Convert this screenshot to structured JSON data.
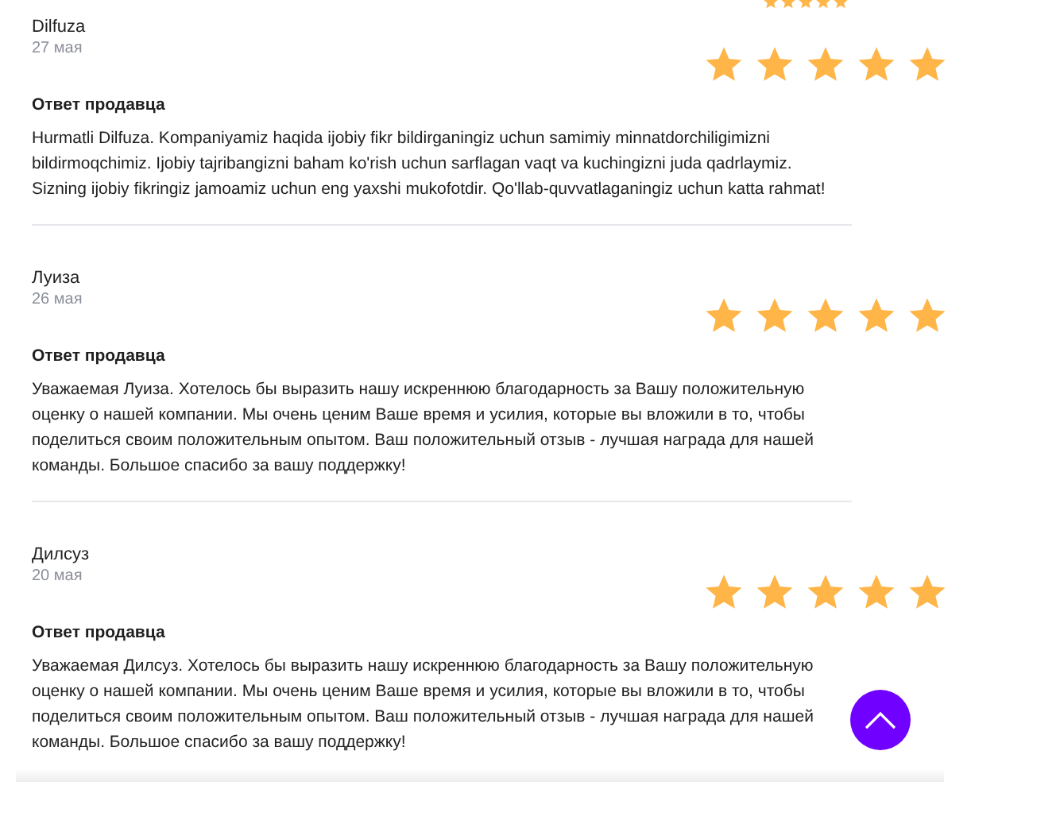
{
  "top_stars": {
    "stars": 5
  },
  "reviews": [
    {
      "name": "Dilfuza",
      "date": "27 мая",
      "stars": 5,
      "reply_title": "Ответ продавца",
      "reply": "Hurmatli Dilfuza. Kompaniyamiz haqida ijobiy fikr bildirganingiz uchun samimiy minnatdorchiligimizni bildirmoqchimiz. Ijobiy tajribangizni baham ko'rish uchun sarflagan vaqt va kuchingizni juda qadrlaymiz. Sizning ijobiy fikringiz jamoamiz uchun eng yaxshi mukofotdir. Qo'llab-quvvatlaganingiz uchun katta rahmat!"
    },
    {
      "name": "Луиза",
      "date": "26 мая",
      "stars": 5,
      "reply_title": "Ответ продавца",
      "reply": "Уважаемая Луиза. Хотелось бы выразить нашу искреннюю благодарность за Вашу положительную оценку о нашей компании. Мы очень ценим Ваше время и усилия, которые вы вложили в то, чтобы поделиться своим положительным опытом. Ваш положительный отзыв - лучшая награда для нашей команды. Большое спасибо за вашу поддержку!"
    },
    {
      "name": "Дилсуз",
      "date": "20 мая",
      "stars": 5,
      "reply_title": "Ответ продавца",
      "reply": "Уважаемая Дилсуз. Хотелось бы выразить нашу искреннюю благодарность за Вашу положительную оценку о нашей компании. Мы очень ценим Ваше время и усилия, которые вы вложили в то, чтобы поделиться своим положительным опытом. Ваш положительный отзыв - лучшая награда для нашей команды. Большое спасибо за вашу поддержку!"
    }
  ]
}
